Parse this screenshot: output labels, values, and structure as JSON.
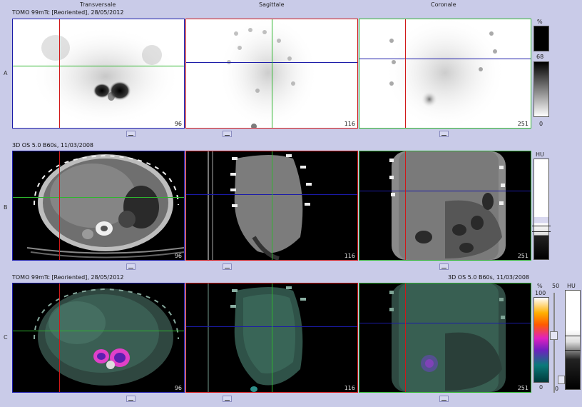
{
  "columns": {
    "transversale": "Transversale",
    "sagittale": "Sagittale",
    "coronale": "Coronale"
  },
  "rows": {
    "a": {
      "letter": "A",
      "info": "TOMO 99mTc [Reoriented], 28/05/2012"
    },
    "b": {
      "letter": "B",
      "info": "3D  OS  5.0  B60s, 11/03/2008"
    },
    "c": {
      "letter": "C",
      "info_left": "TOMO 99mTc [Reoriented], 28/05/2012",
      "info_right": "3D  OS  5.0  B60s, 11/03/2008"
    }
  },
  "slices": {
    "a": [
      "96",
      "116",
      "251"
    ],
    "b": [
      "96",
      "116",
      "251"
    ],
    "c": [
      "96",
      "116",
      "251"
    ]
  },
  "scale_a": {
    "unit": "%",
    "max": "68",
    "min": "0"
  },
  "scale_b": {
    "unit": "HU"
  },
  "scale_c": {
    "unit": "%",
    "max": "100",
    "min": "0",
    "mid": "50",
    "unit2": "HU",
    "min2": "0"
  },
  "colors": {
    "background": "#c9cbe8",
    "crosshair_red": "#d01818",
    "crosshair_green": "#2fb52f",
    "crosshair_blue": "#1b1ba8"
  }
}
